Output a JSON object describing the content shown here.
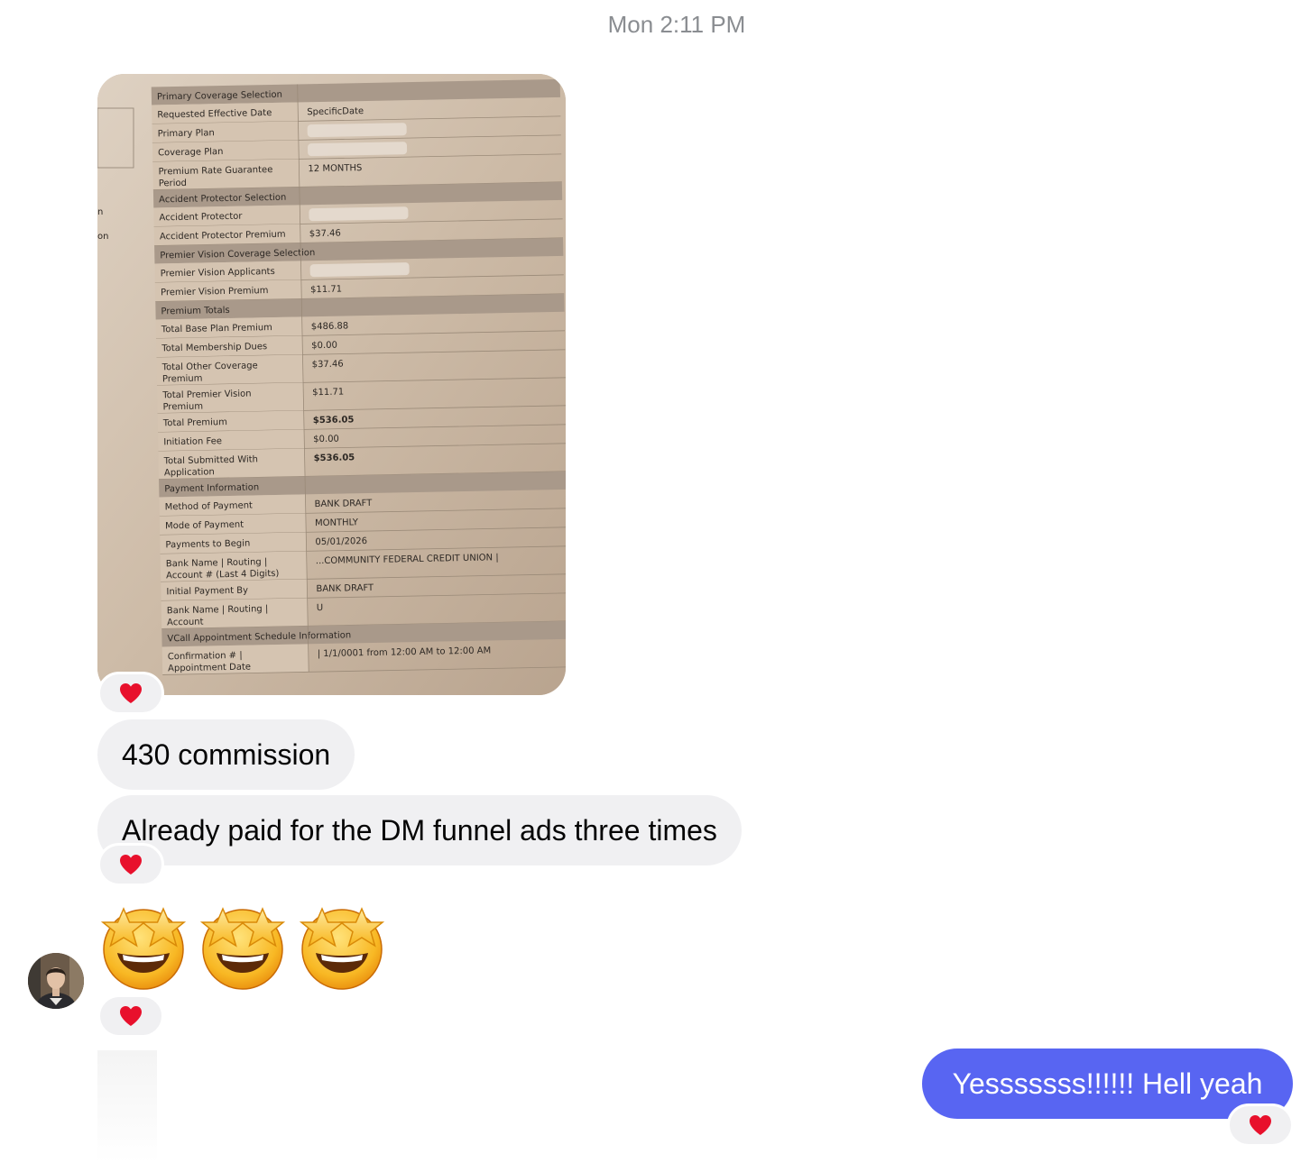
{
  "conversation": {
    "timestamp": "Mon 2:11 PM"
  },
  "photo": {
    "side_labels": [
      "n",
      "on"
    ],
    "sections": [
      {
        "title": "Primary Coverage Selection",
        "rows": [
          {
            "label": [
              "Requested Effective Date"
            ],
            "value": "SpecificDate"
          },
          {
            "label": [
              "Primary Plan"
            ],
            "value": ""
          },
          {
            "label": [
              "Coverage Plan"
            ],
            "value": ""
          },
          {
            "label": [
              "Premium Rate Guarantee",
              "Period"
            ],
            "value": "12 MONTHS"
          }
        ]
      },
      {
        "title": "Accident Protector Selection",
        "rows": [
          {
            "label": [
              "Accident Protector"
            ],
            "value": ""
          },
          {
            "label": [
              "Accident Protector Premium"
            ],
            "value": "$37.46"
          }
        ]
      },
      {
        "title": "Premier Vision Coverage Selection",
        "rows": [
          {
            "label": [
              "Premier Vision Applicants"
            ],
            "value": ""
          },
          {
            "label": [
              "Premier Vision Premium"
            ],
            "value": "$11.71"
          }
        ]
      },
      {
        "title": "Premium Totals",
        "rows": [
          {
            "label": [
              "Total Base Plan Premium"
            ],
            "value": "$486.88"
          },
          {
            "label": [
              "Total Membership Dues"
            ],
            "value": "$0.00"
          },
          {
            "label": [
              "Total Other Coverage",
              "Premium"
            ],
            "value": "$37.46"
          },
          {
            "label": [
              "Total Premier Vision",
              "Premium"
            ],
            "value": "$11.71"
          },
          {
            "label": [
              "Total Premium"
            ],
            "value": "$536.05",
            "bold": true
          },
          {
            "label": [
              "Initiation Fee"
            ],
            "value": "$0.00"
          },
          {
            "label": [
              "Total Submitted With",
              "Application"
            ],
            "value": "$536.05",
            "bold": true
          }
        ]
      },
      {
        "title": "Payment Information",
        "rows": [
          {
            "label": [
              "Method of Payment"
            ],
            "value": "BANK DRAFT"
          },
          {
            "label": [
              "Mode of Payment"
            ],
            "value": "MONTHLY"
          },
          {
            "label": [
              "Payments to Begin"
            ],
            "value": "05/01/2026"
          },
          {
            "label": [
              "Bank Name | Routing |",
              "Account # (Last 4 Digits)"
            ],
            "value": "...COMMUNITY FEDERAL CREDIT UNION |"
          },
          {
            "label": [
              "Initial Payment By"
            ],
            "value": "BANK DRAFT"
          },
          {
            "label": [
              "Bank Name | Routing |",
              "Account"
            ],
            "value": "U"
          }
        ]
      },
      {
        "title": "VCall Appointment Schedule Information",
        "rows": [
          {
            "label": [
              "Confirmation # |",
              "Appointment Date"
            ],
            "value": "| 1/1/0001 from 12:00 AM to 12:00 AM"
          }
        ]
      }
    ]
  },
  "messages": {
    "commission": "430 commission",
    "ads": "Already paid for the DM funnel ads three times",
    "sent": "Yesssssss!!!!!! Hell yeah"
  },
  "icons": {
    "reaction": "red-heart-icon",
    "emoji": "star-struck-emoji-icon",
    "avatar": "contact-avatar"
  },
  "colors": {
    "sent_bubble": "#5865f2",
    "received_bubble": "#f0f0f2",
    "heart": "#e8102c"
  }
}
